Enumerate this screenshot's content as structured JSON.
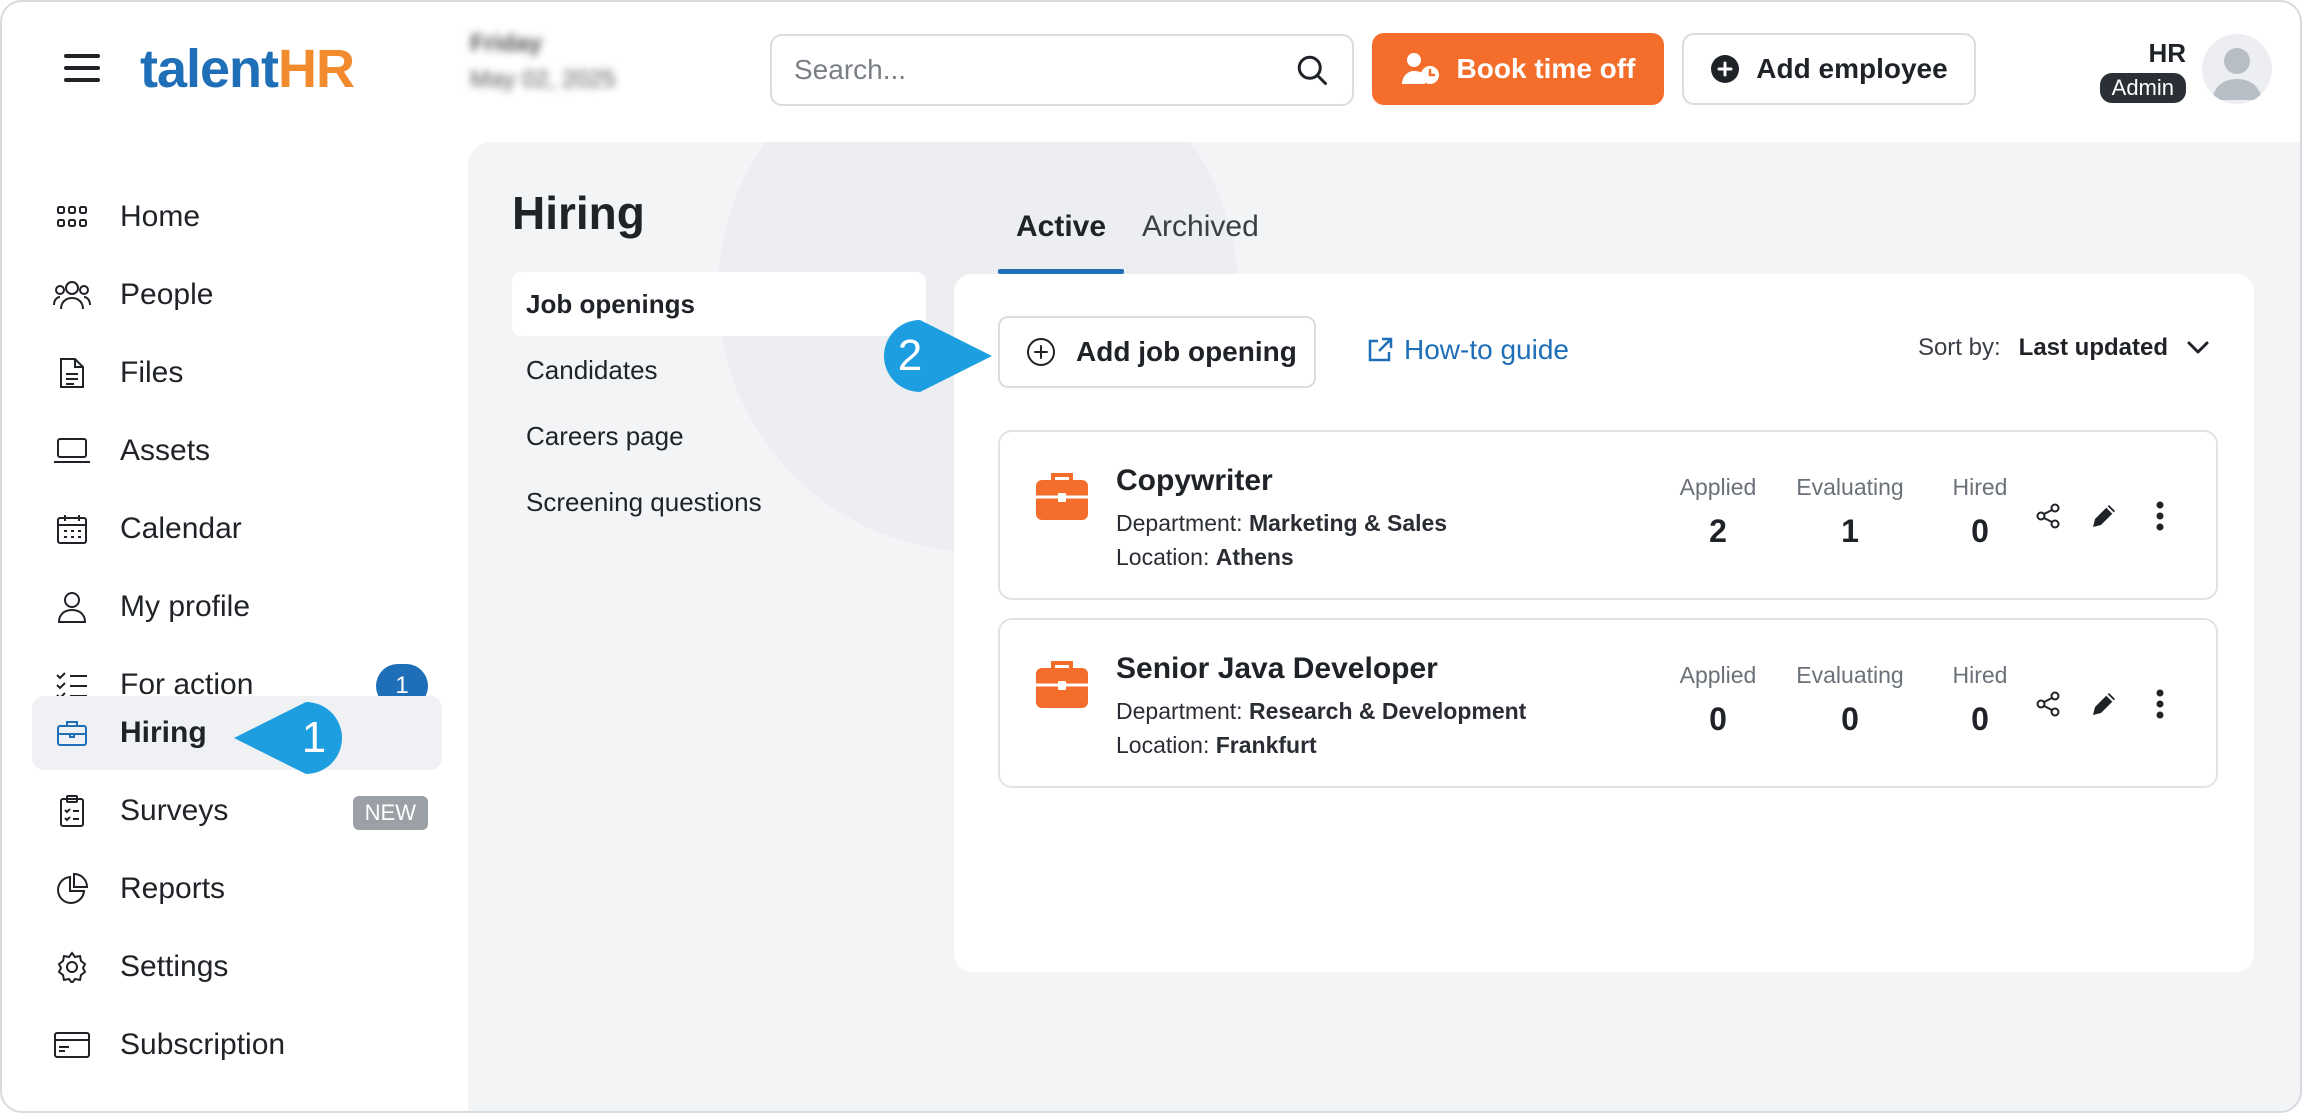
{
  "topbar": {
    "logo_talent": "talent",
    "logo_hr": "HR",
    "date_weekday": "Friday",
    "date_full": "May 02, 2025",
    "search_placeholder": "Search...",
    "book_time_off": "Book time off",
    "add_employee": "Add employee",
    "user_name": "HR",
    "user_role": "Admin"
  },
  "sidebar": {
    "items": [
      {
        "label": "Home",
        "icon": "grid-icon"
      },
      {
        "label": "People",
        "icon": "people-icon"
      },
      {
        "label": "Files",
        "icon": "file-icon"
      },
      {
        "label": "Assets",
        "icon": "laptop-icon"
      },
      {
        "label": "Calendar",
        "icon": "calendar-icon"
      },
      {
        "label": "My profile",
        "icon": "person-icon"
      },
      {
        "label": "For action",
        "icon": "checklist-icon",
        "badge": "1"
      },
      {
        "label": "Hiring",
        "icon": "briefcase-icon",
        "active": true
      },
      {
        "label": "Surveys",
        "icon": "clipboard-icon",
        "tag": "NEW"
      },
      {
        "label": "Reports",
        "icon": "pie-chart-icon"
      },
      {
        "label": "Settings",
        "icon": "gear-icon"
      },
      {
        "label": "Subscription",
        "icon": "credit-card-icon"
      }
    ]
  },
  "main": {
    "title": "Hiring",
    "subnav": [
      "Job openings",
      "Candidates",
      "Careers page",
      "Screening questions"
    ],
    "tabs": [
      "Active",
      "Archived"
    ],
    "add_job_opening": "Add job opening",
    "how_to_guide": "How-to guide",
    "sort_label": "Sort by:",
    "sort_value": "Last updated",
    "stat_labels": {
      "applied": "Applied",
      "evaluating": "Evaluating",
      "hired": "Hired"
    },
    "jobs": [
      {
        "title": "Copywriter",
        "department_label": "Department:",
        "department": "Marketing & Sales",
        "location_label": "Location:",
        "location": "Athens",
        "applied": "2",
        "evaluating": "1",
        "hired": "0"
      },
      {
        "title": "Senior Java Developer",
        "department_label": "Department:",
        "department": "Research & Development",
        "location_label": "Location:",
        "location": "Frankfurt",
        "applied": "0",
        "evaluating": "0",
        "hired": "0"
      }
    ]
  },
  "callouts": {
    "step1": "1",
    "step2": "2"
  },
  "colors": {
    "brand_blue": "#1f6fb8",
    "brand_orange": "#f46d2a",
    "callout_blue": "#1d9ee0"
  }
}
